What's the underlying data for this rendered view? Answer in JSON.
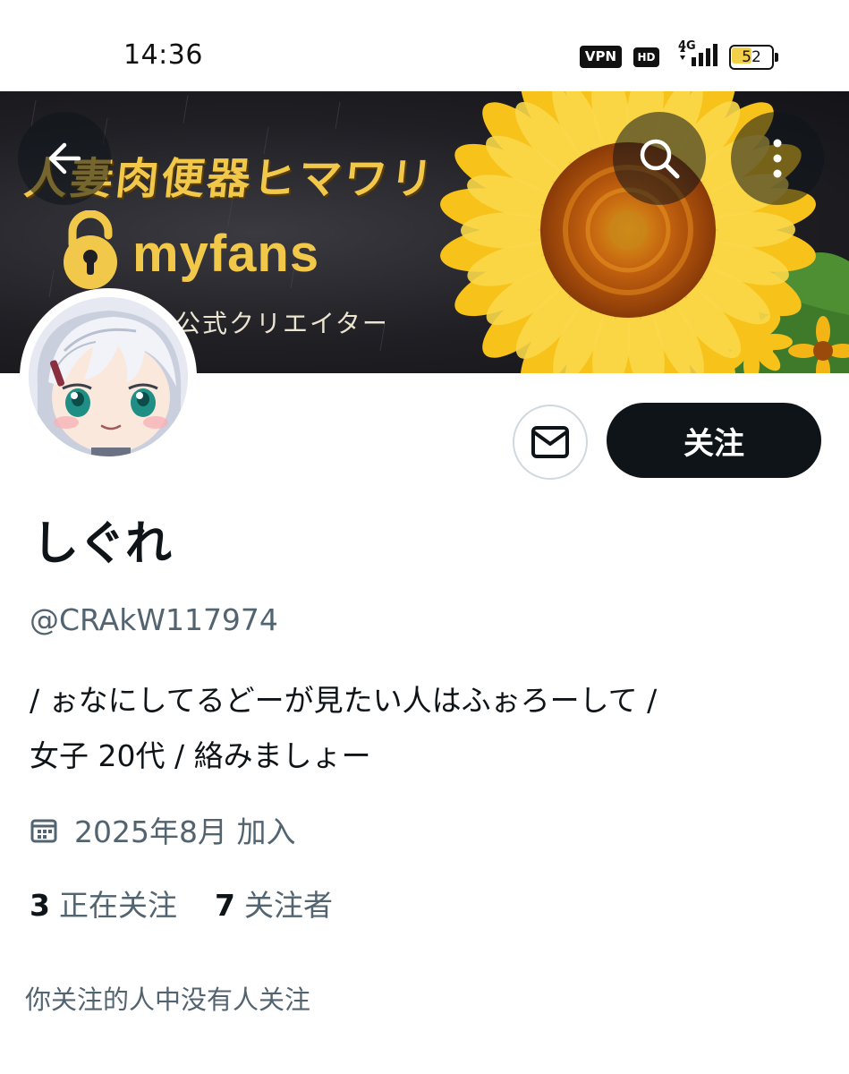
{
  "status_bar": {
    "time": "14:36",
    "vpn": "VPN",
    "hd": "HD",
    "network": "4G",
    "battery": "52",
    "battery_level": 0.52
  },
  "banner": {
    "title": "人妻肉便器ヒマワリ",
    "brand": "myfans",
    "subtitle": "公式クリエイター"
  },
  "icons": {
    "back": "arrow-left-icon",
    "search": "search-icon",
    "more": "more-vertical-icon",
    "message": "mail-icon",
    "calendar": "calendar-icon"
  },
  "actions": {
    "follow_label": "关注"
  },
  "profile": {
    "display_name": "しぐれ",
    "handle": "@CRAkW117974",
    "bio_lines": [
      "/ ぉなにしてるどーが見たい人はふぉろーして /",
      "女子 20代  / 絡みましょー"
    ],
    "joined": "2025年8月 加入",
    "following_count": "3",
    "following_label": "正在关注",
    "followers_count": "7",
    "followers_label": "关注者",
    "mutual_note": "你关注的人中没有人关注"
  },
  "colors": {
    "primary_text": "#0f1419",
    "secondary_text": "#536471",
    "button_dark": "#0f1419",
    "banner_gold": "#f2c84b",
    "sunflower_petal": "#f7c21a",
    "border": "#cfd9de"
  }
}
